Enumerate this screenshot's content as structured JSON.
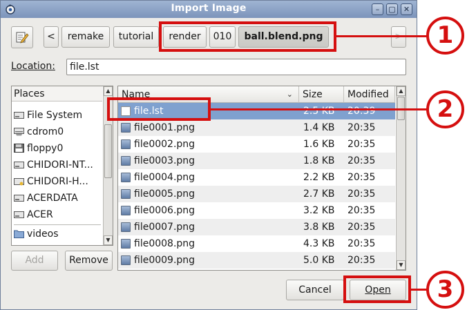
{
  "window": {
    "title": "Import Image",
    "controls": [
      "minimize",
      "maximize",
      "close"
    ],
    "control_glyphs": {
      "minimize": "–",
      "maximize": "▢",
      "close": "✕"
    }
  },
  "pathbar": {
    "left_arrow": "<",
    "right_arrow": ">",
    "segments": [
      {
        "label": "remake",
        "active": false
      },
      {
        "label": "tutorial",
        "active": false
      },
      {
        "label": "render",
        "active": false
      },
      {
        "label": "010",
        "active": false
      },
      {
        "label": "ball.blend.png",
        "active": true
      }
    ]
  },
  "location": {
    "label": "Location:",
    "value": "file.lst"
  },
  "places": {
    "header": "Places",
    "items": [
      {
        "label": "File System",
        "icon": "harddisk-icon"
      },
      {
        "label": "cdrom0",
        "icon": "optical-drive-icon"
      },
      {
        "label": "floppy0",
        "icon": "floppy-icon"
      },
      {
        "label": "CHIDORI-NT...",
        "icon": "harddisk-icon"
      },
      {
        "label": "CHIDORI-H...",
        "icon": "harddisk-icon"
      },
      {
        "label": "ACERDATA",
        "icon": "harddisk-icon"
      },
      {
        "label": "ACER",
        "icon": "harddisk-icon"
      },
      {
        "label": "videos",
        "icon": "folder-icon"
      }
    ],
    "add_label": "Add",
    "remove_label": "Remove"
  },
  "files": {
    "columns": {
      "name": "Name",
      "size": "Size",
      "modified": "Modified"
    },
    "rows": [
      {
        "name": "file.lst",
        "size": "2.5 KB",
        "modified": "20:39",
        "selected": true,
        "icon": "text-file-icon"
      },
      {
        "name": "file0001.png",
        "size": "1.4 KB",
        "modified": "20:35",
        "selected": false,
        "icon": "image-file-icon"
      },
      {
        "name": "file0002.png",
        "size": "1.6 KB",
        "modified": "20:35",
        "selected": false,
        "icon": "image-file-icon"
      },
      {
        "name": "file0003.png",
        "size": "1.8 KB",
        "modified": "20:35",
        "selected": false,
        "icon": "image-file-icon"
      },
      {
        "name": "file0004.png",
        "size": "2.2 KB",
        "modified": "20:35",
        "selected": false,
        "icon": "image-file-icon"
      },
      {
        "name": "file0005.png",
        "size": "2.7 KB",
        "modified": "20:35",
        "selected": false,
        "icon": "image-file-icon"
      },
      {
        "name": "file0006.png",
        "size": "3.2 KB",
        "modified": "20:35",
        "selected": false,
        "icon": "image-file-icon"
      },
      {
        "name": "file0007.png",
        "size": "3.8 KB",
        "modified": "20:35",
        "selected": false,
        "icon": "image-file-icon"
      },
      {
        "name": "file0008.png",
        "size": "4.3 KB",
        "modified": "20:35",
        "selected": false,
        "icon": "image-file-icon"
      },
      {
        "name": "file0009.png",
        "size": "5.0 KB",
        "modified": "20:35",
        "selected": false,
        "icon": "image-file-icon"
      }
    ]
  },
  "actions": {
    "cancel_label": "Cancel",
    "open_label": "Open"
  },
  "callouts": [
    {
      "number": "1"
    },
    {
      "number": "2"
    },
    {
      "number": "3"
    }
  ],
  "colors": {
    "callout": "#d50f0f",
    "selection": "#7fa1cf",
    "titlebar": "#8aa0c4"
  }
}
